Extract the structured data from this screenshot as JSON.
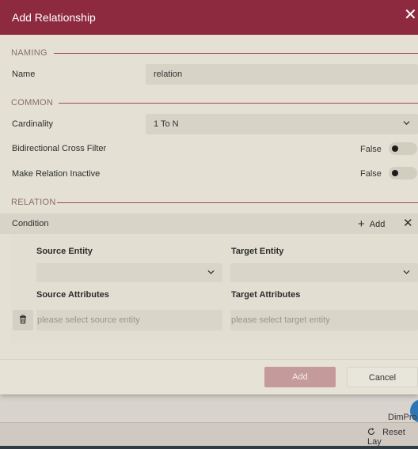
{
  "background": {
    "node_label": "DimPro",
    "reset_label": "Reset Lay"
  },
  "dialog": {
    "title": "Add Relationship",
    "close_glyph": "✕",
    "sections": {
      "naming": "NAMING",
      "common": "COMMON",
      "relation": "RELATION"
    },
    "name": {
      "label": "Name",
      "value": "relation"
    },
    "cardinality": {
      "label": "Cardinality",
      "value": "1 To N"
    },
    "bidirectional": {
      "label": "Bidirectional Cross Filter",
      "state": "False"
    },
    "inactive": {
      "label": "Make Relation Inactive",
      "state": "False"
    },
    "condition": {
      "label": "Condition",
      "add_label": "Add",
      "remove_glyph": "✕"
    },
    "source_entity": {
      "label": "Source Entity",
      "value": ""
    },
    "target_entity": {
      "label": "Target Entity",
      "value": ""
    },
    "source_attributes": {
      "label": "Source Attributes",
      "placeholder": "please select source entity"
    },
    "target_attributes": {
      "label": "Target Attributes",
      "placeholder": "please select target entity"
    },
    "footer": {
      "add_label": "Add",
      "cancel_label": "Cancel"
    }
  },
  "colors": {
    "title_bar": "#8e2a3f",
    "section_line": "#a34a55",
    "dialog_bg": "#e4e1d4",
    "add_button": "#c59a9a"
  },
  "icons": {
    "close": "close-icon",
    "caret": "chevron-down-icon",
    "plus": "plus-icon",
    "trash": "trash-icon",
    "reset": "refresh-icon"
  }
}
